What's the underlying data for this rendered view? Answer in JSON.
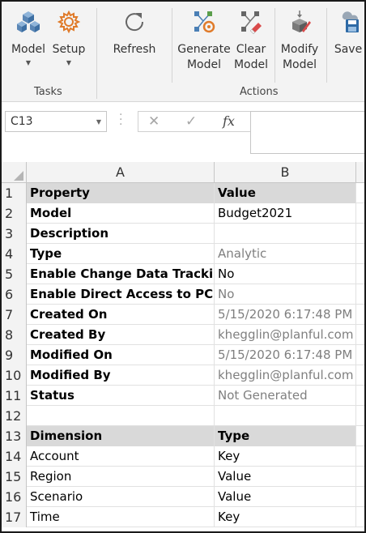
{
  "ribbon": {
    "buttons": [
      {
        "label": "Model",
        "icon": "model-cubes-icon",
        "has_dropdown": true
      },
      {
        "label": "Setup",
        "icon": "setup-gear-icon",
        "has_dropdown": true
      },
      {
        "label": "Refresh",
        "icon": "refresh-icon",
        "has_dropdown": false
      },
      {
        "label": "Generate\nModel",
        "line1": "Generate",
        "line2": "Model",
        "icon": "generate-model-icon"
      },
      {
        "label": "Clear\nModel",
        "line1": "Clear",
        "line2": "Model",
        "icon": "clear-model-icon"
      },
      {
        "label": "Modify\nModel",
        "line1": "Modify",
        "line2": "Model",
        "icon": "modify-model-icon"
      },
      {
        "label": "Save",
        "icon": "save-icon"
      }
    ],
    "groups": {
      "tasks": "Tasks",
      "actions": "Actions"
    }
  },
  "formula_bar": {
    "name_box": "C13",
    "cancel_icon": "✕",
    "enter_icon": "✓",
    "fx_label": "fx",
    "formula": ""
  },
  "columns": {
    "a": "A",
    "b": "B"
  },
  "rows": [
    {
      "num": "1",
      "a": "Property",
      "b": "Value",
      "header": true
    },
    {
      "num": "2",
      "a": "Model",
      "b": "Budget2021"
    },
    {
      "num": "3",
      "a": "Description",
      "b": ""
    },
    {
      "num": "4",
      "a": "Type",
      "b": "Analytic",
      "b_gray": true
    },
    {
      "num": "5",
      "a": "Enable Change Data Tracking",
      "b": "No"
    },
    {
      "num": "6",
      "a": "Enable Direct Access to PCR",
      "b": "No",
      "b_gray": true
    },
    {
      "num": "7",
      "a": "Created On",
      "b": "5/15/2020 6:17:48 PM",
      "b_gray": true
    },
    {
      "num": "8",
      "a": "Created By",
      "b": "khegglin@planful.com",
      "b_gray": true
    },
    {
      "num": "9",
      "a": "Modified On",
      "b": "5/15/2020 6:17:48 PM",
      "b_gray": true
    },
    {
      "num": "10",
      "a": "Modified By",
      "b": "khegglin@planful.com",
      "b_gray": true
    },
    {
      "num": "11",
      "a": "Status",
      "b": "Not Generated",
      "b_gray": true
    },
    {
      "num": "12",
      "a": "",
      "b": ""
    },
    {
      "num": "13",
      "a": "Dimension",
      "b": "Type",
      "header": true
    },
    {
      "num": "14",
      "a": "Account",
      "b": "Key"
    },
    {
      "num": "15",
      "a": "Region",
      "b": "Value"
    },
    {
      "num": "16",
      "a": "Scenario",
      "b": "Value"
    },
    {
      "num": "17",
      "a": "Time",
      "b": "Key"
    }
  ]
}
